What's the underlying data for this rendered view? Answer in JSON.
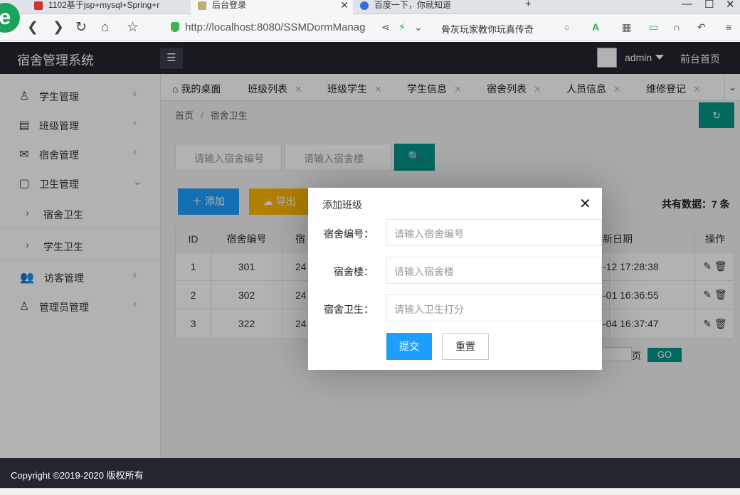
{
  "browser": {
    "tabs": [
      {
        "title": "1102基于jsp+mysql+Spring+r",
        "active": false
      },
      {
        "title": "后台登录",
        "active": true
      },
      {
        "title": "百度一下，你就知道",
        "active": false
      }
    ],
    "new_tab": "+",
    "url": "http://localhost:8080/SSMDormManag",
    "search_text": "骨灰玩家教你玩真传奇"
  },
  "header": {
    "title": "宿舍管理系统",
    "user": "admin",
    "front_home": "前台首页"
  },
  "sidebar": {
    "items": [
      {
        "label": "学生管理",
        "icon": "user-icon"
      },
      {
        "label": "班级管理",
        "icon": "class-icon"
      },
      {
        "label": "宿舍管理",
        "icon": "dorm-icon"
      },
      {
        "label": "卫生管理",
        "icon": "hygiene-icon"
      },
      {
        "label": "宿舍卫生",
        "sub": true
      },
      {
        "label": "学生卫生",
        "sub": true
      },
      {
        "label": "访客管理",
        "icon": "visitor-icon"
      },
      {
        "label": "管理员管理",
        "icon": "admin-icon"
      }
    ]
  },
  "page_tabs": [
    "我的桌面",
    "班级列表",
    "班级学生",
    "学生信息",
    "宿舍列表",
    "人员信息",
    "维修登记"
  ],
  "breadcrumb": {
    "home": "首页",
    "current": "宿舍卫生"
  },
  "search": {
    "dorm_no_placeholder": "请输入宿舍编号",
    "building_placeholder": "请输入宿舍楼"
  },
  "toolbar": {
    "add": "添加",
    "export": "导出",
    "total": "共有数据：7 条"
  },
  "table": {
    "headers": [
      "ID",
      "宿舍编号",
      "宿",
      "新日期",
      "操作"
    ],
    "rows": [
      {
        "id": "1",
        "dorm": "301",
        "building": "24",
        "date": "-12 17:28:38"
      },
      {
        "id": "2",
        "dorm": "302",
        "building": "24",
        "date": "-01 16:36:55"
      },
      {
        "id": "3",
        "dorm": "322",
        "building": "24",
        "date": "-04 16:37:47"
      }
    ]
  },
  "pager": {
    "page_label": "页",
    "go": "GO"
  },
  "modal": {
    "title": "添加班级",
    "fields": [
      {
        "label": "宿舍编号：",
        "placeholder": "请输入宿舍编号"
      },
      {
        "label": "宿舍楼：",
        "placeholder": "请输入宿舍楼"
      },
      {
        "label": "宿舍卫生：",
        "placeholder": "请输入卫生打分"
      }
    ],
    "submit": "提交",
    "reset": "重置"
  },
  "footer": {
    "copyright": "Copyright ©2019-2020 版权所有"
  },
  "colors": {
    "header_bg": "#23262e",
    "primary": "#1e9fff",
    "teal": "#009688",
    "warn": "#ffb800"
  }
}
